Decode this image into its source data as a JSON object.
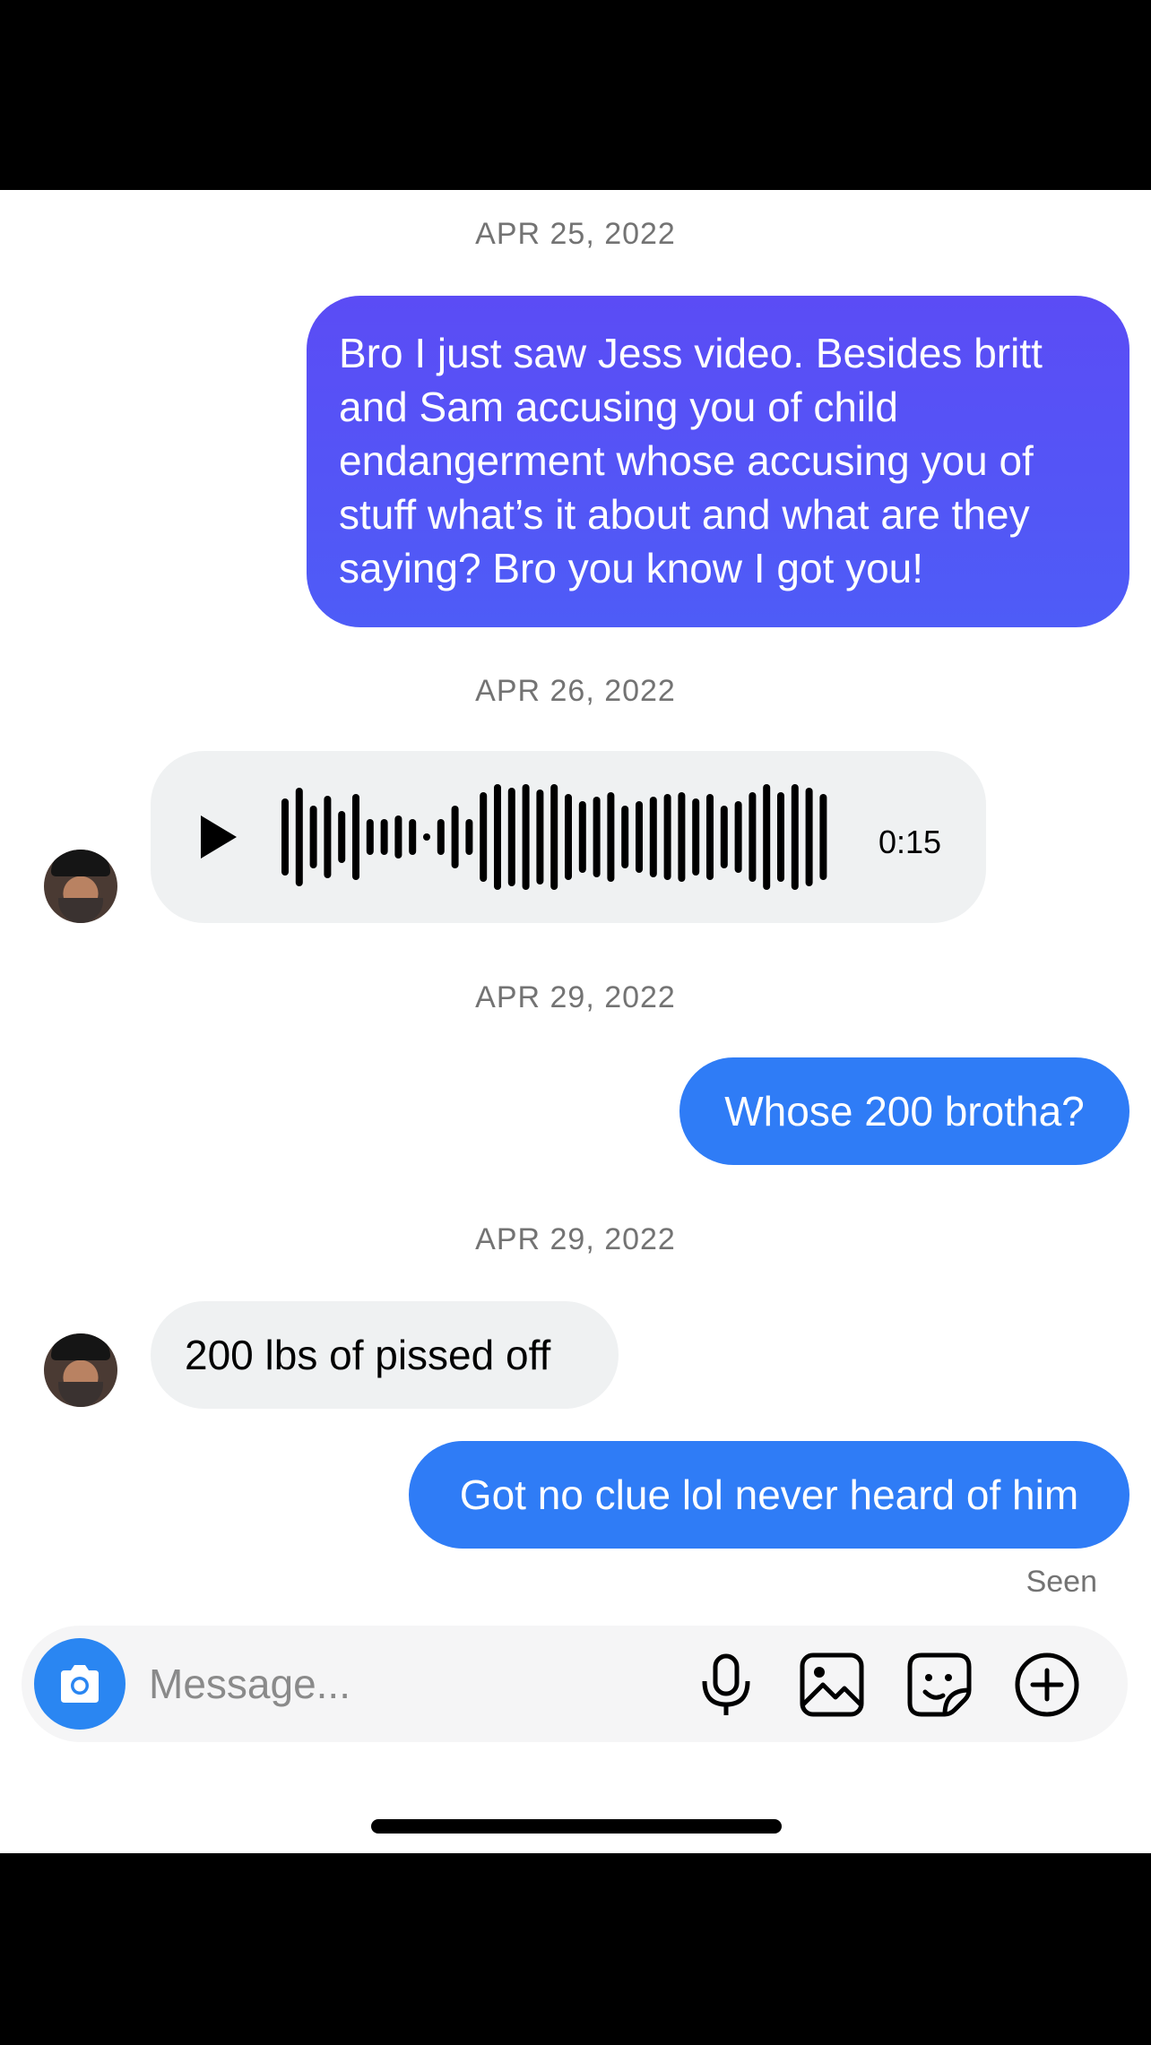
{
  "thread": {
    "dates": [
      "APR 25, 2022",
      "APR 26, 2022",
      "APR 29, 2022",
      "APR 29, 2022"
    ],
    "messages": [
      {
        "from": "me",
        "text": "Bro I just saw Jess video. Besides britt and Sam accusing you of child endangerment whose accusing you of stuff what’s it about and what are they saying? Bro you know I got you!"
      },
      {
        "from": "them",
        "type": "voice",
        "duration": "0:15"
      },
      {
        "from": "me",
        "text": "Whose 200 brotha?"
      },
      {
        "from": "them",
        "text": "200 lbs of pissed off"
      },
      {
        "from": "me",
        "text": "Got no clue lol never heard of him"
      }
    ],
    "status": "Seen"
  },
  "composer": {
    "placeholder": "Message...",
    "icons": [
      "camera-icon",
      "microphone-icon",
      "gallery-icon",
      "sticker-icon",
      "plus-icon"
    ]
  },
  "colors": {
    "outgoing_purple": "#5353f6",
    "outgoing_blue": "#2f7cf6",
    "incoming_gray": "#eff1f2",
    "camera_blue": "#2a86f2"
  }
}
